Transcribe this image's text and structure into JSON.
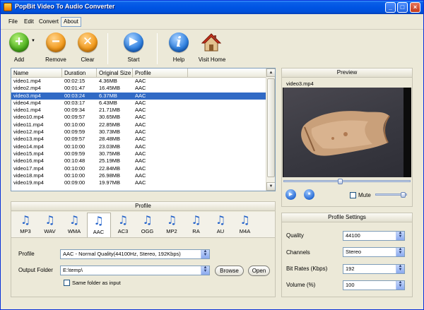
{
  "window": {
    "title": "PopBit Video To Audio Converter"
  },
  "menu": {
    "items": [
      "File",
      "Edit",
      "Convert",
      "About"
    ]
  },
  "toolbar": {
    "add": "Add",
    "remove": "Remove",
    "clear": "Clear",
    "start": "Start",
    "help": "Help",
    "visit_home": "Visit Home"
  },
  "filelist": {
    "columns": [
      "Name",
      "Duration",
      "Original Size",
      "Profile"
    ],
    "rows": [
      [
        "video1.mp4",
        "00:02:15",
        "4.36MB",
        "AAC"
      ],
      [
        "video2.mp4",
        "00:01:47",
        "16.45MB",
        "AAC"
      ],
      [
        "video3.mp4",
        "00:03:24",
        "6.37MB",
        "AAC"
      ],
      [
        "video4.mp4",
        "00:03:17",
        "6.43MB",
        "AAC"
      ],
      [
        "video1.mp4",
        "00:09:34",
        "21.71MB",
        "AAC"
      ],
      [
        "video10.mp4",
        "00:09:57",
        "30.65MB",
        "AAC"
      ],
      [
        "video11.mp4",
        "00:10:00",
        "22.85MB",
        "AAC"
      ],
      [
        "video12.mp4",
        "00:09:59",
        "30.73MB",
        "AAC"
      ],
      [
        "video13.mp4",
        "00:09:57",
        "28.48MB",
        "AAC"
      ],
      [
        "video14.mp4",
        "00:10:00",
        "23.03MB",
        "AAC"
      ],
      [
        "video15.mp4",
        "00:09:59",
        "30.75MB",
        "AAC"
      ],
      [
        "video16.mp4",
        "00:10:48",
        "25.19MB",
        "AAC"
      ],
      [
        "video17.mp4",
        "00:10:00",
        "22.84MB",
        "AAC"
      ],
      [
        "video18.mp4",
        "00:10:00",
        "26.98MB",
        "AAC"
      ],
      [
        "video19.mp4",
        "00:09:00",
        "19.97MB",
        "AAC"
      ]
    ],
    "selected_index": 2
  },
  "profile_panel": {
    "title": "Profile",
    "formats": [
      "MP3",
      "WAV",
      "WMA",
      "AAC",
      "AC3",
      "OGG",
      "MP2",
      "RA",
      "AU",
      "M4A"
    ],
    "active_format": "AAC",
    "profile_label": "Profile",
    "profile_value": "AAC - Normal Quality(44100Hz, Stereo, 192Kbps)",
    "output_label": "Output Folder",
    "output_value": "E:\\temp\\",
    "browse": "Browse",
    "open": "Open",
    "same_folder": "Same folder as input"
  },
  "preview": {
    "title": "Preview",
    "file": "video3.mp4",
    "mute": "Mute",
    "seek_position": 0.45,
    "volume_level": 0.95
  },
  "profile_settings": {
    "title": "Profile Settings",
    "fields": [
      {
        "label": "Quality",
        "value": "44100"
      },
      {
        "label": "Channels",
        "value": "Stereo"
      },
      {
        "label": "Bit Rates (Kbps)",
        "value": "192"
      },
      {
        "label": "Volume (%)",
        "value": "100"
      }
    ]
  },
  "colors": {
    "title_bar": "#0054e3",
    "selection": "#316ac5",
    "note_icon": "#1f5fc9"
  }
}
